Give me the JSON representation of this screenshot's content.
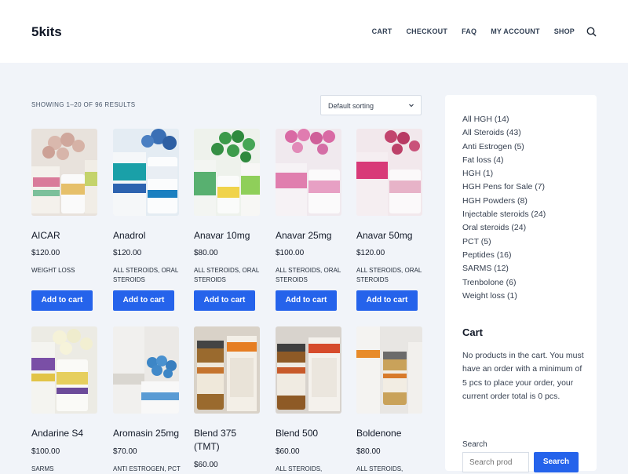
{
  "site": {
    "logo": "5kits"
  },
  "nav": {
    "items": [
      "CART",
      "CHECKOUT",
      "FAQ",
      "MY ACCOUNT",
      "SHOP"
    ]
  },
  "shop": {
    "results_text": "SHOWING 1–20 OF 96 RESULTS",
    "sort_label": "Default sorting",
    "add_to_cart_label": "Add to cart"
  },
  "products": [
    {
      "name": "AICAR",
      "price": "$120.00",
      "categories": "WEIGHT LOSS",
      "image_icon": "pill-bottle-photo"
    },
    {
      "name": "Anadrol",
      "price": "$120.00",
      "categories": "ALL STEROIDS, ORAL STEROIDS",
      "image_icon": "pill-bottle-photo"
    },
    {
      "name": "Anavar 10mg",
      "price": "$80.00",
      "categories": "ALL STEROIDS, ORAL STEROIDS",
      "image_icon": "pill-bottle-photo"
    },
    {
      "name": "Anavar 25mg",
      "price": "$100.00",
      "categories": "ALL STEROIDS, ORAL STEROIDS",
      "image_icon": "pill-bottle-photo"
    },
    {
      "name": "Anavar 50mg",
      "price": "$120.00",
      "categories": "ALL STEROIDS, ORAL STEROIDS",
      "image_icon": "pill-bottle-photo"
    },
    {
      "name": "Andarine S4",
      "price": "$100.00",
      "categories": "SARMS",
      "image_icon": "pill-bottle-photo"
    },
    {
      "name": "Aromasin 25mg",
      "price": "$70.00",
      "categories": "ANTI ESTROGEN, PCT",
      "image_icon": "pill-bottle-photo"
    },
    {
      "name": "Blend 375 (TMT)",
      "price": "$60.00",
      "categories": "",
      "image_icon": "vial-photo"
    },
    {
      "name": "Blend 500",
      "price": "$60.00",
      "categories": "ALL STEROIDS,",
      "image_icon": "vial-photo"
    },
    {
      "name": "Boldenone",
      "price": "$80.00",
      "categories": "ALL STEROIDS,",
      "image_icon": "vial-photo"
    }
  ],
  "sidebar": {
    "categories": [
      "All HGH (14)",
      "All Steroids (43)",
      "Anti Estrogen (5)",
      "Fat loss (4)",
      "HGH (1)",
      "HGH Pens for Sale (7)",
      "HGH Powders (8)",
      "Injectable steroids (24)",
      "Oral steroids (24)",
      "PCT (5)",
      "Peptides (16)",
      "SARMS (12)",
      "Trenbolone (6)",
      "Weight loss (1)"
    ],
    "cart_title": "Cart",
    "cart_text": "No products in the cart. You must have an order with a minimum of 5 pcs to place your order, your current order total is 0 pcs.",
    "search_label": "Search",
    "search_placeholder": "Search prod",
    "search_button": "Search"
  },
  "colors": {
    "accent": "#2563eb",
    "page_bg": "#f1f4f9"
  }
}
